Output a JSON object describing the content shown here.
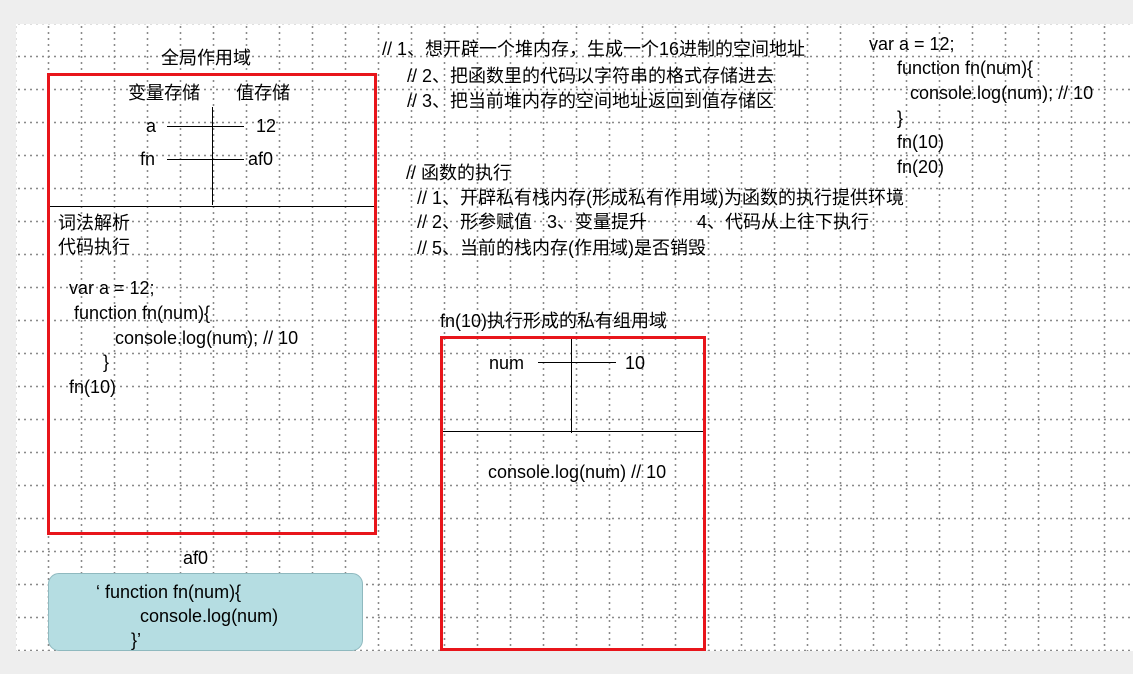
{
  "global_scope": {
    "title": "全局作用域",
    "col_var": "变量存储",
    "col_val": "值存储",
    "rows": [
      {
        "name": "a",
        "value": "12"
      },
      {
        "name": "fn",
        "value": "af0"
      }
    ],
    "section_1": "词法解析",
    "section_2": "代码执行",
    "code": [
      "var a = 12;",
      "function fn(num){",
      "console.log(num); // 10",
      "}",
      "fn(10)"
    ]
  },
  "heap": {
    "address": "af0",
    "code": [
      "‘ function fn(num){",
      "console.log(num)",
      "}’"
    ]
  },
  "notes_create": [
    "// 1、想开辟一个堆内存，生成一个16进制的空间地址",
    "// 2、把函数里的代码以字符串的格式存储进去",
    "// 3、把当前堆内存的空间地址返回到值存储区"
  ],
  "notes_exec": [
    "// 函数的执行",
    "// 1、开辟私有栈内存(形成私有作用域)为函数的执行提供环境",
    "// 2、形参赋值   3、变量提升          4、代码从上往下执行",
    "// 5、当前的栈内存(作用域)是否销毁"
  ],
  "code_right": [
    "var a = 12;",
    "function fn(num){",
    "console.log(num); // 10",
    "}",
    "fn(10)",
    "fn(20)"
  ],
  "private_scope": {
    "title": "fn(10)执行形成的私有组用域",
    "var_name": "num",
    "var_value": "10",
    "code": "console.log(num) // 10"
  },
  "colors": {
    "border": "#e8151b",
    "heap_fill": "#b5dde2",
    "grid_dots": "#8a8a8a"
  }
}
